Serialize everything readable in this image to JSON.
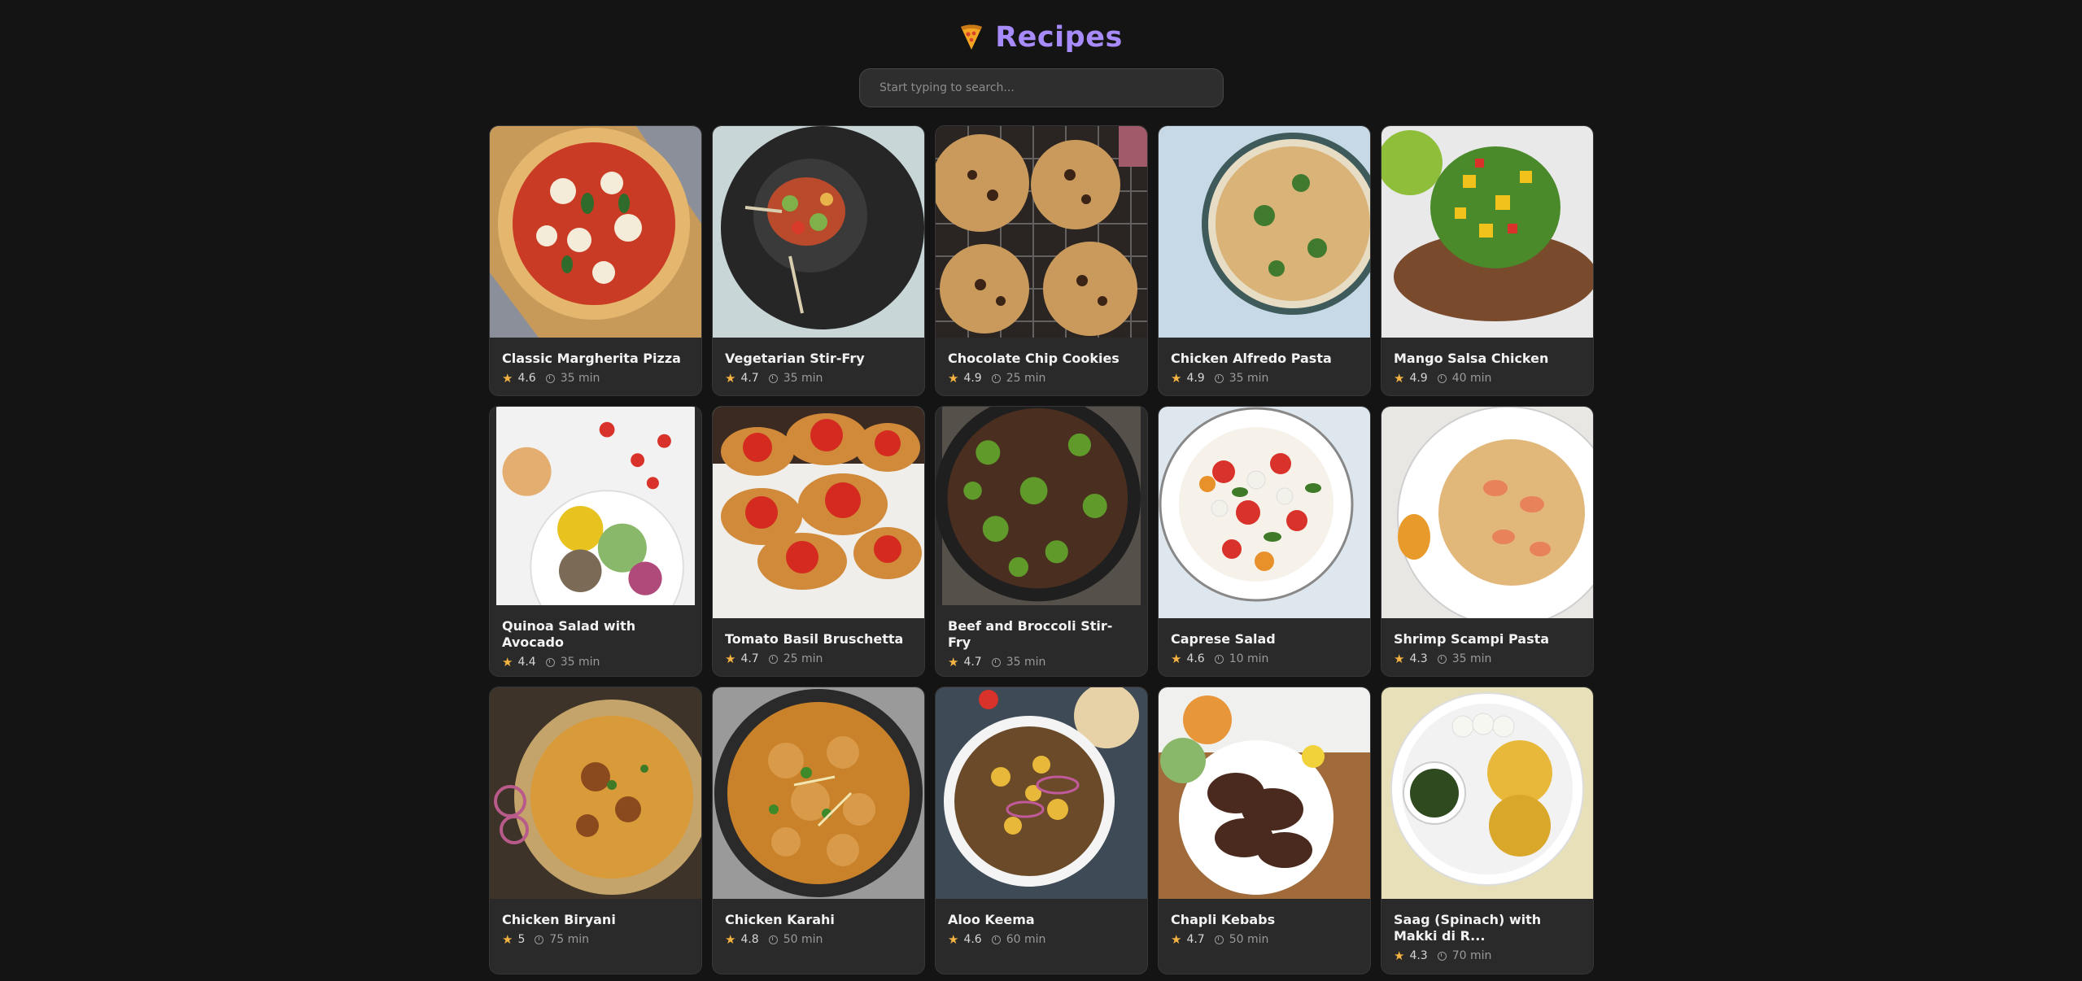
{
  "header": {
    "title": "Recipes",
    "logo_icon": "pizza-slice-icon",
    "accent_color": "#a78bfa"
  },
  "search": {
    "placeholder": "Start typing to search...",
    "value": ""
  },
  "rating_icon": "star-icon",
  "time_icon": "clock-icon",
  "recipes": [
    {
      "name": "Classic Margherita Pizza",
      "rating": "4.6",
      "time": "35 min",
      "image": "margherita-pizza"
    },
    {
      "name": "Vegetarian Stir-Fry",
      "rating": "4.7",
      "time": "35 min",
      "image": "vegetable-stir-fry-bowl"
    },
    {
      "name": "Chocolate Chip Cookies",
      "rating": "4.9",
      "time": "25 min",
      "image": "cookies-on-rack"
    },
    {
      "name": "Chicken Alfredo Pasta",
      "rating": "4.9",
      "time": "35 min",
      "image": "penne-broccoli-bowl"
    },
    {
      "name": "Mango Salsa Chicken",
      "rating": "4.9",
      "time": "40 min",
      "image": "grilled-chicken-mango-salsa"
    },
    {
      "name": "Quinoa Salad with Avocado",
      "rating": "4.4",
      "time": "35 min",
      "image": "quinoa-salad-bowl"
    },
    {
      "name": "Tomato Basil Bruschetta",
      "rating": "4.7",
      "time": "25 min",
      "image": "bruschetta-plate"
    },
    {
      "name": "Beef and Broccoli Stir-Fry",
      "rating": "4.7",
      "time": "35 min",
      "image": "beef-broccoli-pan"
    },
    {
      "name": "Caprese Salad",
      "rating": "4.6",
      "time": "10 min",
      "image": "caprese-salad-plate"
    },
    {
      "name": "Shrimp Scampi Pasta",
      "rating": "4.3",
      "time": "35 min",
      "image": "shrimp-linguine-plate"
    },
    {
      "name": "Chicken Biryani",
      "rating": "5",
      "time": "75 min",
      "image": "biryani-platter"
    },
    {
      "name": "Chicken Karahi",
      "rating": "4.8",
      "time": "50 min",
      "image": "karahi-curry-pan"
    },
    {
      "name": "Aloo Keema",
      "rating": "4.6",
      "time": "60 min",
      "image": "aloo-keema-bowl"
    },
    {
      "name": "Chapli Kebabs",
      "rating": "4.7",
      "time": "50 min",
      "image": "kebabs-on-board"
    },
    {
      "name": "Saag (Spinach) with Makki di R...",
      "rating": "4.3",
      "time": "70 min",
      "image": "saag-makki-roti-plate"
    }
  ]
}
